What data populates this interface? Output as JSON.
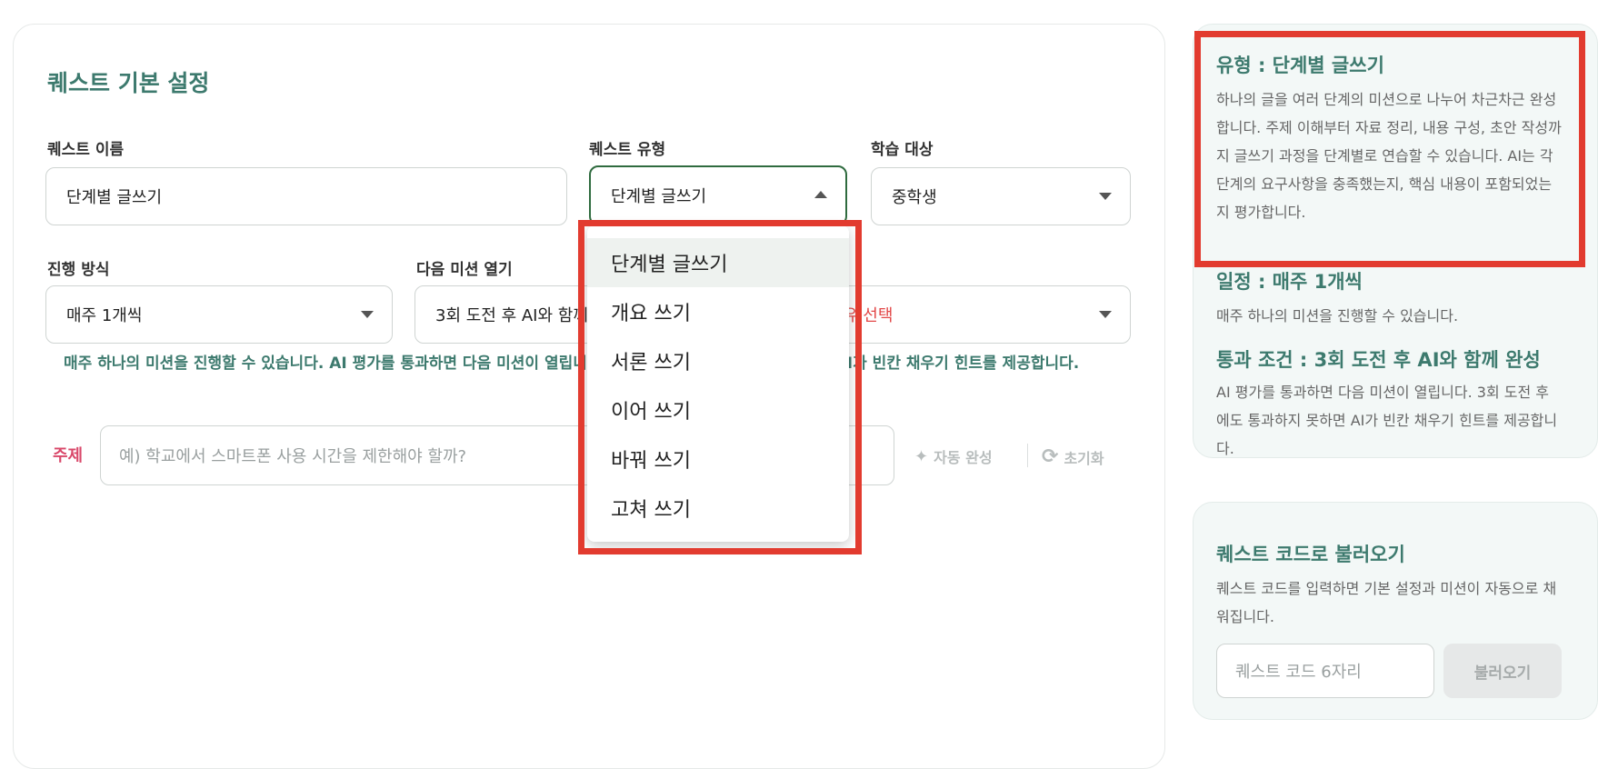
{
  "form": {
    "title": "퀘스트 기본 설정",
    "name_label": "퀘스트 이름",
    "name_value": "단계별 글쓰기",
    "type_label": "퀘스트 유형",
    "type_value": "단계별 글쓰기",
    "target_label": "학습 대상",
    "target_value": "중학생",
    "mode_label": "진행 방식",
    "mode_value": "매주 1개씩",
    "next_label": "다음 미션 열기",
    "next_value": "3회 도전 후 AI와 함께",
    "hidden_select_value": "유 선택",
    "info_text": "매주 하나의 미션을 진행할 수 있습니다. AI 평가를 통과하면 다음 미션이 열립니다. 3회 도전 후에도 통과하지 못하면 AI가 빈칸 채우기 힌트를 제공합니다.",
    "topic_label": "주제",
    "topic_placeholder": "예) 학교에서 스마트폰 사용 시간을 제한해야 할까?",
    "auto_complete_label": "자동 완성",
    "reset_label": "초기화"
  },
  "dropdown": {
    "options": [
      "단계별 글쓰기",
      "개요 쓰기",
      "서론 쓰기",
      "이어 쓰기",
      "바꿔 쓰기",
      "고쳐 쓰기"
    ],
    "selected_index": 0
  },
  "side_info": {
    "type_head": "유형 : 단계별 글쓰기",
    "type_body": "하나의 글을 여러 단계의 미션으로 나누어 차근차근 완성합니다. 주제 이해부터 자료 정리, 내용 구성, 초안 작성까지 글쓰기 과정을 단계별로 연습할 수 있습니다. AI는 각 단계의 요구사항을 충족했는지, 핵심 내용이 포함되었는지 평가합니다.",
    "schedule_head": "일정 : 매주 1개씩",
    "schedule_body": "매주 하나의 미션을 진행할 수 있습니다.",
    "pass_head": "통과 조건 : 3회 도전 후 AI와 함께 완성",
    "pass_body": "AI 평가를 통과하면 다음 미션이 열립니다. 3회 도전 후에도 통과하지 못하면 AI가 빈칸 채우기 힌트를 제공합니다."
  },
  "code_load": {
    "head": "퀘스트 코드로 불러오기",
    "body": "퀘스트 코드를 입력하면 기본 설정과 미션이 자동으로 채워집니다.",
    "input_placeholder": "퀘스트 코드 6자리",
    "button_label": "불러오기"
  },
  "colors": {
    "accent": "#3d7a6e",
    "highlight_frame": "#e23b2f",
    "topic_label": "#d9486a",
    "focus_border": "#2f6b3f"
  }
}
